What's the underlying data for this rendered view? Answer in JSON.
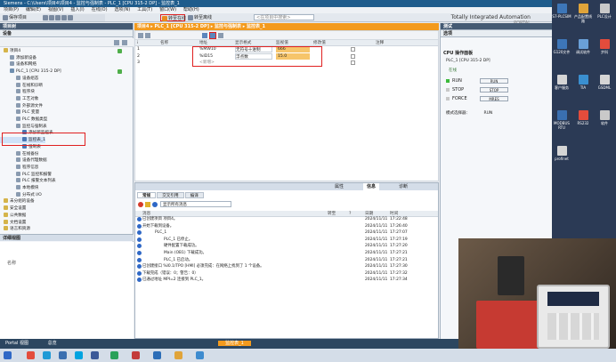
{
  "window": {
    "title": "Siemens - C:\\Users\\项目4\\项目4 - 监控与强制表 - PLC_1 [CPU 315-2 DP] - 监控表_1",
    "brand": "Totally Integrated Automation",
    "brand_sub": "PORTAL"
  },
  "menu": [
    "项目(P)",
    "编辑(E)",
    "视图(V)",
    "插入(I)",
    "在线(O)",
    "选项(N)",
    "工具(T)",
    "窗口(W)",
    "帮助(H)"
  ],
  "toolbar": {
    "save": "保存项目",
    "go_online": "转至在线",
    "go_offline": "转至离线",
    "search_placeholder": "<在项目中搜索>"
  },
  "project_tree": {
    "title": "项目树",
    "devices_tab": "设备",
    "items": [
      {
        "label": "项目4",
        "level": 0,
        "status": true
      },
      {
        "label": "添加新设备",
        "level": 1
      },
      {
        "label": "设备和网络",
        "level": 1
      },
      {
        "label": "PLC_1 [CPU 315-2 DP]",
        "level": 1,
        "status": true
      },
      {
        "label": "设备组态",
        "level": 2
      },
      {
        "label": "在线和诊断",
        "level": 2
      },
      {
        "label": "程序块",
        "level": 2
      },
      {
        "label": "工艺对象",
        "level": 2
      },
      {
        "label": "外部源文件",
        "level": 2
      },
      {
        "label": "PLC 变量",
        "level": 2
      },
      {
        "label": "PLC 数据类型",
        "level": 2
      },
      {
        "label": "监控与强制表",
        "level": 2
      },
      {
        "label": "添加新监控表",
        "level": 3
      },
      {
        "label": "监控表_1",
        "level": 3
      },
      {
        "label": "强制表",
        "level": 3
      },
      {
        "label": "在线备份",
        "level": 2
      },
      {
        "label": "设备代理数据",
        "level": 2
      },
      {
        "label": "程序信息",
        "level": 2
      },
      {
        "label": "PLC 监控和报警",
        "level": 2
      },
      {
        "label": "PLC 报警文本列表",
        "level": 2
      },
      {
        "label": "本地模块",
        "level": 2
      },
      {
        "label": "分布式 I/O",
        "level": 2
      },
      {
        "label": "未分组的设备",
        "level": 0
      },
      {
        "label": "安全设置",
        "level": 0
      },
      {
        "label": "公共数据",
        "level": 0
      },
      {
        "label": "文档设置",
        "level": 0
      },
      {
        "label": "语言和资源",
        "level": 0
      }
    ],
    "details_title": "详细视图",
    "details_col": "名称"
  },
  "breadcrumb": [
    "项目4",
    "PLC_1 [CPU 315-2 DP]",
    "监控与强制表",
    "监控表_1"
  ],
  "watch_table": {
    "columns": [
      "i",
      "名称",
      "地址",
      "显示格式",
      "监视值",
      "修改值",
      "",
      "注释"
    ],
    "rows": [
      {
        "index": "1",
        "name": "",
        "address": "%MW10",
        "format": "无符号十进制",
        "monitor": "666",
        "modify": ""
      },
      {
        "index": "2",
        "name": "",
        "address": "%ID15",
        "format": "浮点数",
        "monitor": "15.0",
        "modify": ""
      },
      {
        "index": "3",
        "name": "",
        "address": "<新增>",
        "format": "",
        "monitor": "",
        "modify": ""
      }
    ]
  },
  "inspector": {
    "tabs": [
      "属性",
      "信息",
      "诊断"
    ],
    "subtabs": [
      "常规",
      "交叉引用",
      "编译"
    ],
    "filter": "显示所有消息",
    "columns": [
      "消息",
      "转至",
      "?",
      "日期",
      "时间"
    ],
    "messages": [
      {
        "text": "已创建项目 项目4。",
        "date": "2024/11/11",
        "time": "17:22:48"
      },
      {
        "text": "开始下载到设备。",
        "date": "2024/11/11",
        "time": "17:26:40"
      },
      {
        "text": "PLC_1",
        "date": "2024/11/11",
        "time": "17:27:07"
      },
      {
        "text": "PLC_1 已停止。",
        "date": "2024/11/11",
        "time": "17:27:19"
      },
      {
        "text": "硬件配置下载成功。",
        "date": "2024/11/11",
        "time": "17:27:20"
      },
      {
        "text": "Main (OB1) 下载成功。",
        "date": "2024/11/11",
        "time": "17:27:21"
      },
      {
        "text": "PLC_1 已启动。",
        "date": "2024/11/11",
        "time": "17:27:21"
      },
      {
        "text": "已创建接口 %I0.1/TPO [HMI] 必须完成：在网络上找到了 1 个设备。",
        "date": "2024/11/11",
        "time": "17:27:30"
      },
      {
        "text": "下载完成（错误：0；警告：0）",
        "date": "2024/11/11",
        "time": "17:27:32"
      },
      {
        "text": "已通过地址 MPI=2 连接到 PLC_1。",
        "date": "2024/11/11",
        "time": "17:27:34"
      }
    ]
  },
  "tasks": {
    "title": "测试",
    "section": "选项",
    "panel_title": "CPU 操作面板",
    "device": "PLC_1 [CPU 315-2 DP]",
    "status_label": "在线",
    "leds": [
      {
        "label": "RUN",
        "color": "#3cba3c"
      },
      {
        "label": "STOP",
        "color": "#c8c8c8"
      },
      {
        "label": "FORCE",
        "color": "#c8c8c8"
      }
    ],
    "buttons": [
      "RUN",
      "STOP",
      "MRES"
    ],
    "mode_label": "模式选择器：",
    "mode_value": "RUN"
  },
  "statusbar": {
    "portal_view": "Portal 视图",
    "overview": "总览",
    "editor": "监控表_1"
  },
  "desktop_icons": [
    {
      "label": "S7-PLCSIM"
    },
    {
      "label": "产品配置线路"
    },
    {
      "label": "PLC设计"
    },
    {
      "label": "G120文件"
    },
    {
      "label": "调试软件"
    },
    {
      "label": "步科"
    },
    {
      "label": "客户服务"
    },
    {
      "label": "TIA"
    },
    {
      "label": "GSDML"
    },
    {
      "label": "MODBUS RTU"
    },
    {
      "label": "RS232"
    },
    {
      "label": "软件"
    },
    {
      "label": "profinet"
    }
  ],
  "colors": {
    "accent": "#f39a1d",
    "taskbar_blue": "#1e5c8c",
    "highlight_red": "#e02020"
  }
}
